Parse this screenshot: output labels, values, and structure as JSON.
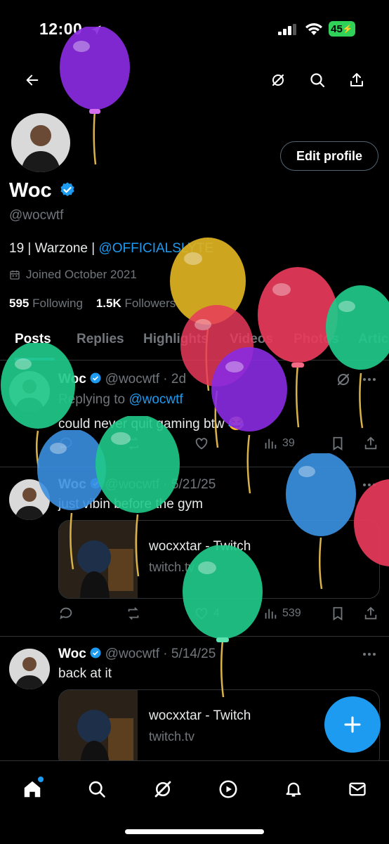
{
  "status_bar": {
    "time": "12:00",
    "battery": "45"
  },
  "profile": {
    "display_name": "Woc",
    "handle": "@wocwtf",
    "bio_text": "19 | Warzone | ",
    "bio_link": "@OFFICIALSLYTE",
    "joined": "Joined October 2021",
    "following_count": "595",
    "following_label": "Following",
    "followers_count": "1.5K",
    "followers_label": "Followers",
    "edit_label": "Edit profile"
  },
  "tabs": [
    "Posts",
    "Replies",
    "Highlights",
    "Videos",
    "Photos",
    "Artic"
  ],
  "posts": [
    {
      "name": "Woc",
      "meta": "@wocwtf · 2d",
      "replying_prefix": "Replying to ",
      "replying_handle": "@wocwtf",
      "text": "could never quit gaming btw 😂",
      "views": "39"
    },
    {
      "name": "Woc",
      "meta": "@wocwtf · 5/21/25",
      "text": "just vibin before the gym",
      "card_title": "wocxxtar - Twitch",
      "card_domain": "twitch.tv",
      "likes": "4",
      "views": "539"
    },
    {
      "name": "Woc",
      "meta": "@wocwtf · 5/14/25",
      "text": "back at it",
      "card_title": "wocxxtar - Twitch",
      "card_domain": "twitch.tv"
    }
  ],
  "colors": {
    "accent": "#1d9bf0",
    "background": "#000000",
    "muted": "#71767b",
    "battery": "#30d158"
  },
  "icons": [
    "back-arrow-icon",
    "grok-icon",
    "search-icon",
    "share-icon",
    "verified-icon",
    "calendar-icon",
    "reply-icon",
    "repost-icon",
    "like-icon",
    "views-icon",
    "bookmark-icon",
    "more-icon",
    "plus-icon",
    "home-icon",
    "explore-icon",
    "play-icon",
    "bell-icon",
    "mail-icon"
  ]
}
